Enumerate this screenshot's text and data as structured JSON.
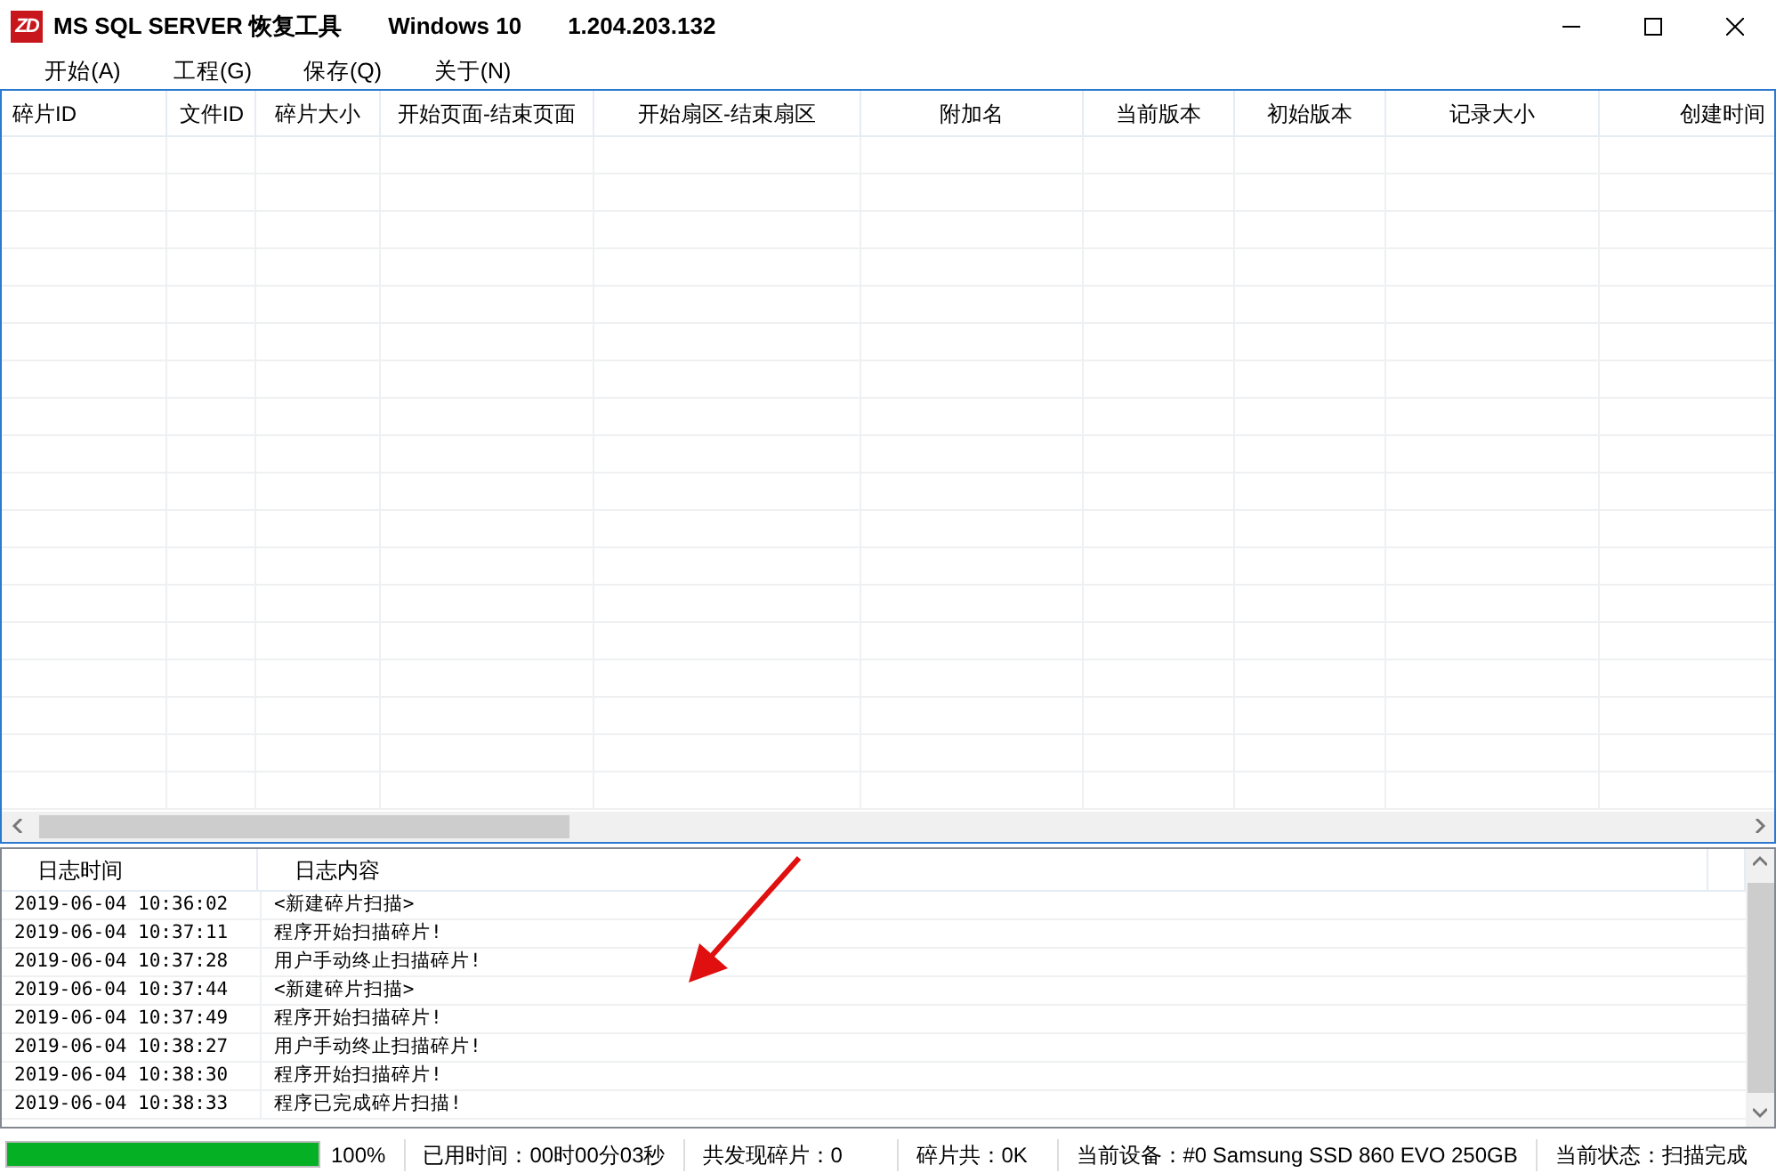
{
  "window": {
    "logo": "ZD",
    "title": "MS SQL SERVER 恢复工具",
    "os": "Windows 10",
    "version": "1.204.203.132"
  },
  "menu": [
    {
      "label": "开始(A)"
    },
    {
      "label": "工程(G)"
    },
    {
      "label": "保存(Q)"
    },
    {
      "label": "关于(N)"
    }
  ],
  "fragments_table": {
    "columns": [
      {
        "label": "碎片ID"
      },
      {
        "label": "文件ID"
      },
      {
        "label": "碎片大小"
      },
      {
        "label": "开始页面-结束页面"
      },
      {
        "label": "开始扇区-结束扇区"
      },
      {
        "label": "附加名"
      },
      {
        "label": "当前版本"
      },
      {
        "label": "初始版本"
      },
      {
        "label": "记录大小"
      },
      {
        "label": "创建时间"
      }
    ]
  },
  "log": {
    "columns": [
      "日志时间",
      "日志内容"
    ],
    "rows": [
      {
        "time": "2019-06-04 10:36:02",
        "message": "<新建碎片扫描>"
      },
      {
        "time": "2019-06-04 10:37:11",
        "message": "程序开始扫描碎片!"
      },
      {
        "time": "2019-06-04 10:37:28",
        "message": "用户手动终止扫描碎片!"
      },
      {
        "time": "2019-06-04 10:37:44",
        "message": "<新建碎片扫描>"
      },
      {
        "time": "2019-06-04 10:37:49",
        "message": "程序开始扫描碎片!"
      },
      {
        "time": "2019-06-04 10:38:27",
        "message": "用户手动终止扫描碎片!"
      },
      {
        "time": "2019-06-04 10:38:30",
        "message": "程序开始扫描碎片!"
      },
      {
        "time": "2019-06-04 10:38:33",
        "message": "程序已完成碎片扫描!"
      }
    ]
  },
  "status_bar": {
    "progress": {
      "level": 1.0,
      "reading": "100%"
    },
    "fields": [
      "已用时间：00时00分03秒",
      "共发现碎片：0",
      "碎片共：0K",
      "当前设备：#0 Samsung SSD 860 EVO 250GB",
      "当前状态：扫描完成"
    ]
  }
}
